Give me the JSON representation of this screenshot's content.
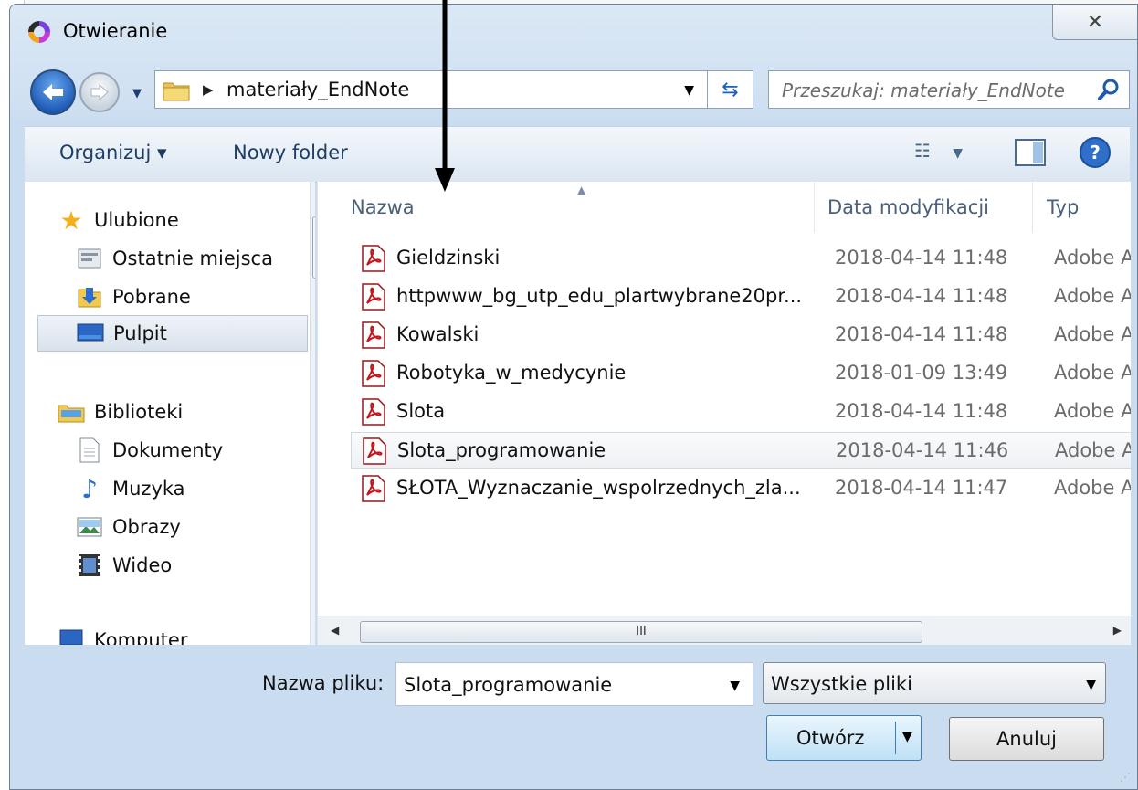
{
  "window": {
    "title": "Otwieranie",
    "close_glyph": "✕"
  },
  "address": {
    "path": "materiały_EndNote",
    "search_placeholder": "Przeszukaj: materiały_EndNote"
  },
  "toolbar": {
    "organize_label": "Organizuj ▾",
    "new_folder_label": "Nowy folder"
  },
  "nav": {
    "favorites": "Ulubione",
    "recent": "Ostatnie miejsca",
    "downloads": "Pobrane",
    "desktop": "Pulpit",
    "libraries": "Biblioteki",
    "documents": "Dokumenty",
    "music": "Muzyka",
    "pictures": "Obrazy",
    "videos": "Wideo",
    "computer": "Komputer"
  },
  "columns": {
    "name": "Nazwa",
    "date": "Data modyfikacji",
    "type": "Typ"
  },
  "files": [
    {
      "name": "Gieldzinski",
      "date": "2018-04-14 11:48",
      "type": "Adobe Ac"
    },
    {
      "name": "httpwww_bg_utp_edu_plartwybrane20pr...",
      "date": "2018-04-14 11:48",
      "type": "Adobe Ac"
    },
    {
      "name": "Kowalski",
      "date": "2018-04-14 11:48",
      "type": "Adobe Ac"
    },
    {
      "name": "Robotyka_w_medycynie",
      "date": "2018-01-09 13:49",
      "type": "Adobe Ac"
    },
    {
      "name": "Slota",
      "date": "2018-04-14 11:48",
      "type": "Adobe Ac"
    },
    {
      "name": "Slota_programowanie",
      "date": "2018-04-14 11:46",
      "type": "Adobe Ac"
    },
    {
      "name": "SŁOTA_Wyznaczanie_wspolrzednych_zla...",
      "date": "2018-04-14 11:47",
      "type": "Adobe Ac"
    }
  ],
  "footer": {
    "filename_label": "Nazwa pliku:",
    "filename_value": "Slota_programowanie",
    "filter_value": "Wszystkie pliki",
    "open_label": "Otwórz",
    "cancel_label": "Anuluj",
    "hscroll_grip": "III"
  },
  "colors": {
    "accent": "#1f5db8",
    "pdf_red": "#c4161c"
  }
}
